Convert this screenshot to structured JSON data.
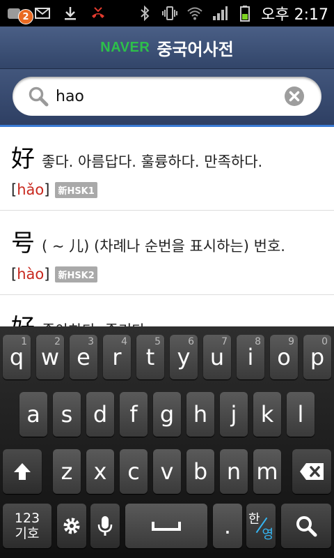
{
  "status_bar": {
    "notification_count": "2",
    "time": "오후 2:17"
  },
  "header": {
    "brand": "NAVER",
    "title": "중국어사전"
  },
  "search": {
    "value": "hao"
  },
  "results": [
    {
      "hanzi": "好",
      "meaning": "좋다. 아름답다. 훌륭하다. 만족하다.",
      "pinyin": "hǎo",
      "level": "新HSK1"
    },
    {
      "hanzi": "号",
      "meaning": "( ~ 儿) (차례나 순번을 표시하는) 번호.",
      "pinyin": "hào",
      "level": "新HSK2"
    },
    {
      "hanzi": "好",
      "meaning": "좋아하다. 즐기다."
    }
  ],
  "keyboard": {
    "row1": [
      {
        "label": "q",
        "num": "1"
      },
      {
        "label": "w",
        "num": "2"
      },
      {
        "label": "e",
        "num": "3"
      },
      {
        "label": "r",
        "num": "4"
      },
      {
        "label": "t",
        "num": "5"
      },
      {
        "label": "y",
        "num": "6"
      },
      {
        "label": "u",
        "num": "7"
      },
      {
        "label": "i",
        "num": "8"
      },
      {
        "label": "o",
        "num": "9"
      },
      {
        "label": "p",
        "num": "0"
      }
    ],
    "row2": [
      "a",
      "s",
      "d",
      "f",
      "g",
      "h",
      "j",
      "k",
      "l"
    ],
    "row3": [
      "z",
      "x",
      "c",
      "v",
      "b",
      "n",
      "m"
    ],
    "symbols_label_1": "123",
    "symbols_label_2": "기호",
    "period": ".",
    "lang_ko": "한",
    "lang_en": "영"
  }
}
